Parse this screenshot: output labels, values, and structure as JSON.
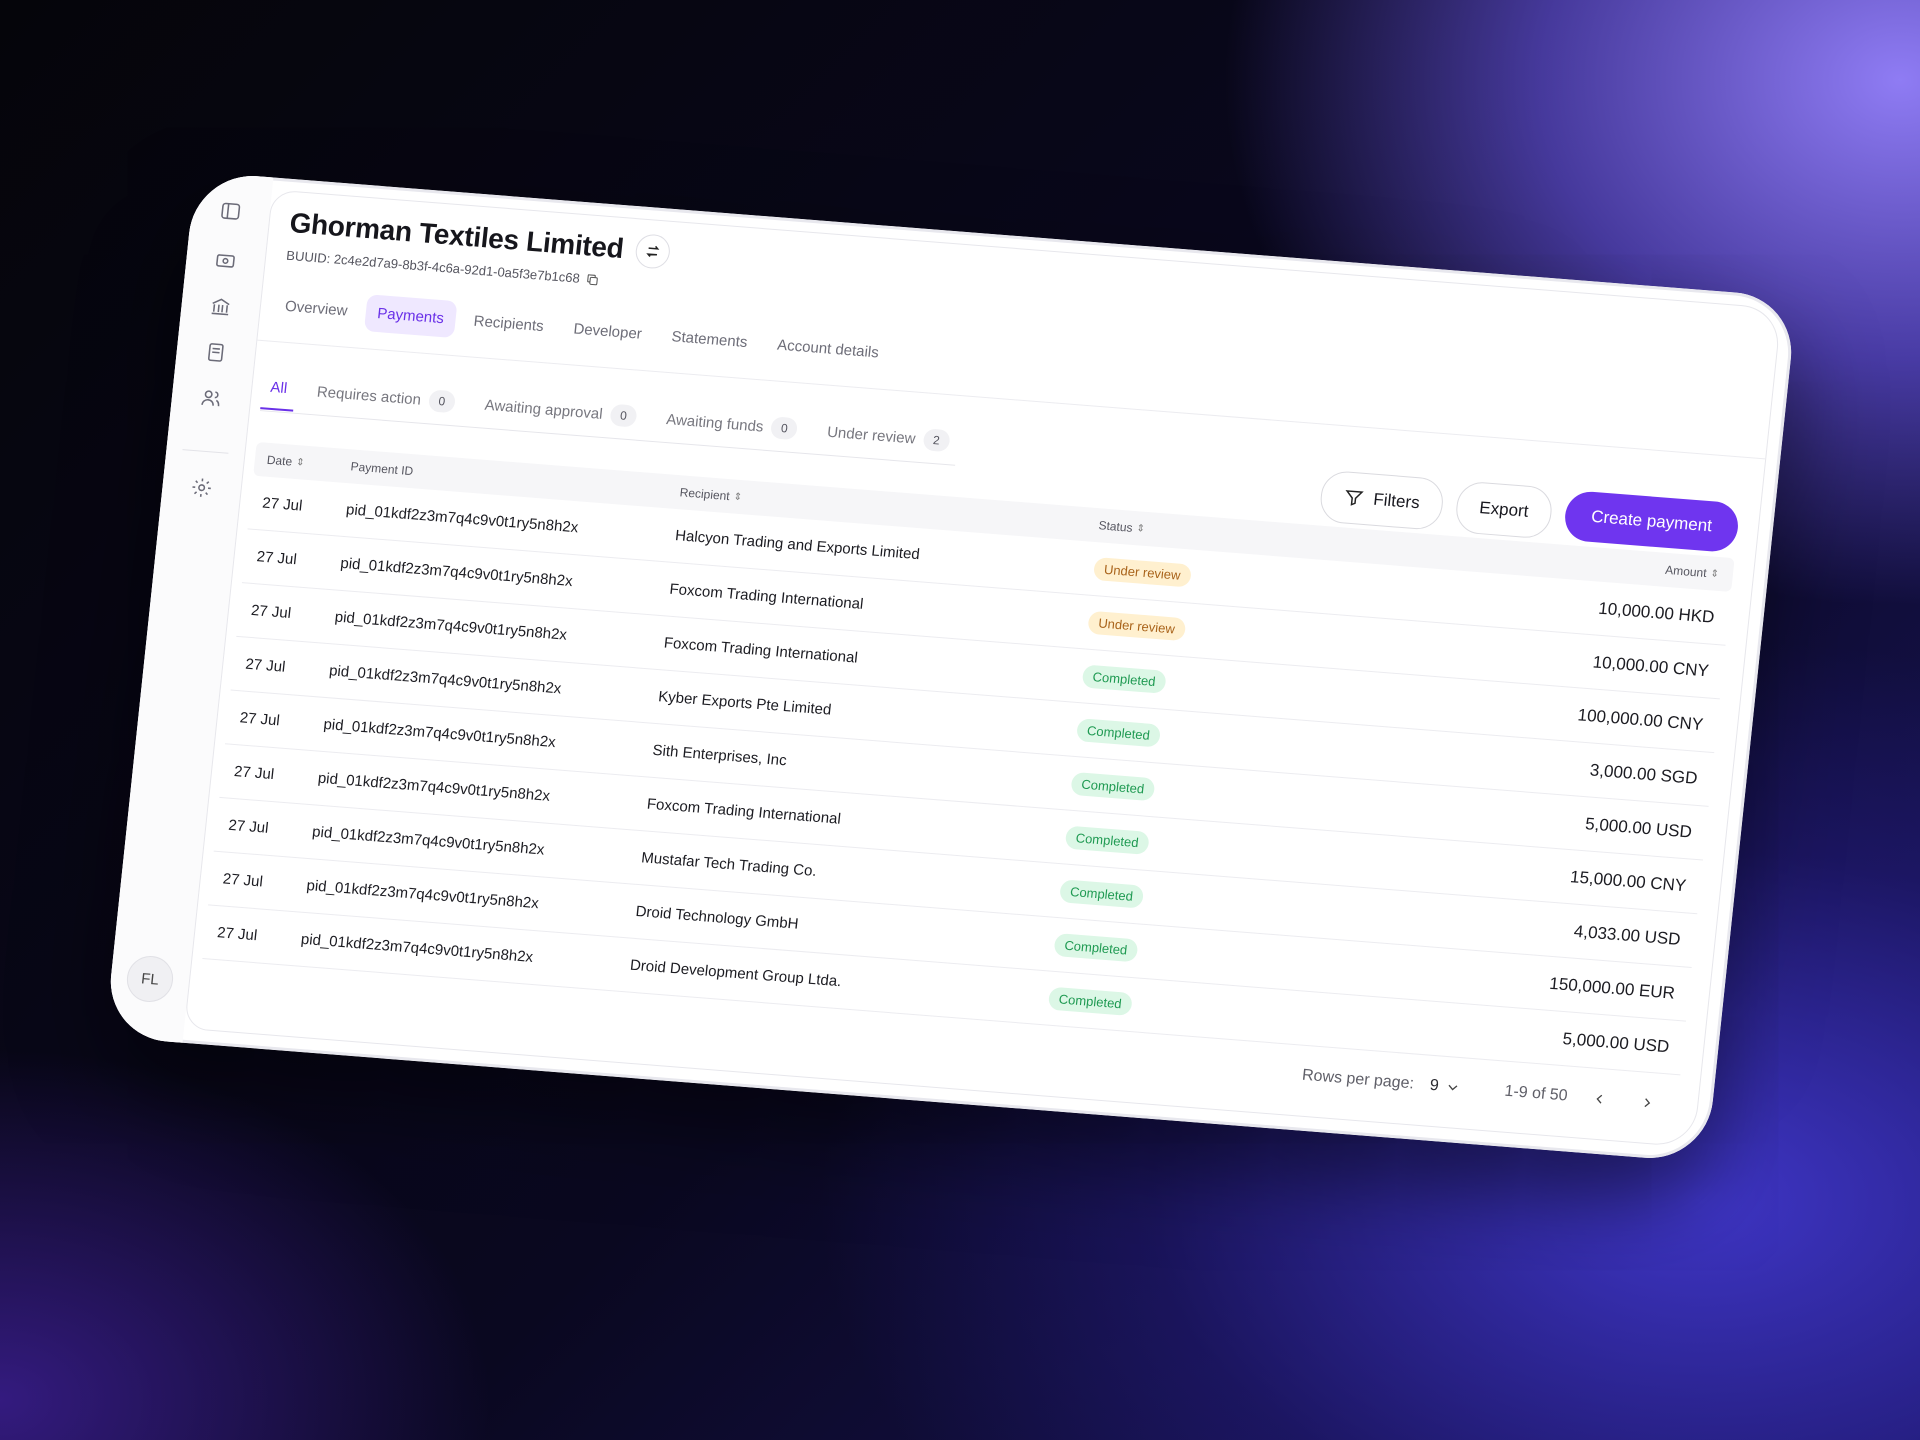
{
  "header": {
    "title": "Ghorman Textiles Limited",
    "buuid": "BUUID: 2c4e2d7a9-8b3f-4c6a-92d1-0a5f3e7b1c68"
  },
  "tabs": [
    "Overview",
    "Payments",
    "Recipients",
    "Developer",
    "Statements",
    "Account details"
  ],
  "active_tab": "Payments",
  "subtabs": [
    {
      "label": "All",
      "count": null
    },
    {
      "label": "Requires action",
      "count": "0"
    },
    {
      "label": "Awaiting approval",
      "count": "0"
    },
    {
      "label": "Awaiting funds",
      "count": "0"
    },
    {
      "label": "Under review",
      "count": "2"
    }
  ],
  "active_subtab": "All",
  "actions": {
    "filters_label": "Filters",
    "export_label": "Export",
    "create_label": "Create payment"
  },
  "table": {
    "columns": {
      "date": "Date",
      "payment_id": "Payment ID",
      "recipient": "Recipient",
      "status": "Status",
      "amount": "Amount"
    },
    "rows": [
      {
        "date": "27 Jul",
        "pid": "pid_01kdf2z3m7q4c9v0t1ry5n8h2x",
        "recipient": "Halcyon Trading and Exports Limited",
        "status": "Under review",
        "amount": "10,000.00 HKD"
      },
      {
        "date": "27 Jul",
        "pid": "pid_01kdf2z3m7q4c9v0t1ry5n8h2x",
        "recipient": "Foxcom Trading International",
        "status": "Under review",
        "amount": "10,000.00 CNY"
      },
      {
        "date": "27 Jul",
        "pid": "pid_01kdf2z3m7q4c9v0t1ry5n8h2x",
        "recipient": "Foxcom Trading International",
        "status": "Completed",
        "amount": "100,000.00 CNY"
      },
      {
        "date": "27 Jul",
        "pid": "pid_01kdf2z3m7q4c9v0t1ry5n8h2x",
        "recipient": "Kyber Exports Pte Limited",
        "status": "Completed",
        "amount": "3,000.00 SGD"
      },
      {
        "date": "27 Jul",
        "pid": "pid_01kdf2z3m7q4c9v0t1ry5n8h2x",
        "recipient": "Sith Enterprises, Inc",
        "status": "Completed",
        "amount": "5,000.00 USD"
      },
      {
        "date": "27 Jul",
        "pid": "pid_01kdf2z3m7q4c9v0t1ry5n8h2x",
        "recipient": "Foxcom Trading International",
        "status": "Completed",
        "amount": "15,000.00 CNY"
      },
      {
        "date": "27 Jul",
        "pid": "pid_01kdf2z3m7q4c9v0t1ry5n8h2x",
        "recipient": "Mustafar Tech Trading Co.",
        "status": "Completed",
        "amount": "4,033.00 USD"
      },
      {
        "date": "27 Jul",
        "pid": "pid_01kdf2z3m7q4c9v0t1ry5n8h2x",
        "recipient": "Droid Technology GmbH",
        "status": "Completed",
        "amount": "150,000.00 EUR"
      },
      {
        "date": "27 Jul",
        "pid": "pid_01kdf2z3m7q4c9v0t1ry5n8h2x",
        "recipient": "Droid Development Group Ltda.",
        "status": "Completed",
        "amount": "5,000.00 USD"
      }
    ]
  },
  "pager": {
    "rows_per_page_label": "Rows per page:",
    "rows_per_page_value": "9",
    "range": "1-9 of 50"
  },
  "user": {
    "initials": "FL"
  },
  "colors": {
    "accent": "#6f35ef",
    "review_bg": "#fff0cf",
    "done_bg": "#dcf7e6"
  }
}
